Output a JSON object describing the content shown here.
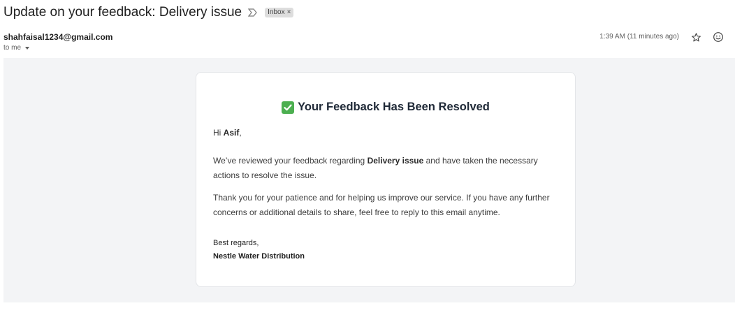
{
  "header": {
    "subject": "Update on your feedback: Delivery issue",
    "label": "Inbox",
    "label_remove": "×"
  },
  "message": {
    "sender": "shahfaisal1234@gmail.com",
    "to": "to me",
    "timestamp": "1:39 AM (11 minutes ago)"
  },
  "email": {
    "title": "Your Feedback Has Been Resolved",
    "greeting_prefix": "Hi ",
    "name": "Asif",
    "greeting_suffix": ",",
    "p1_prefix": "We’ve reviewed your feedback regarding ",
    "p1_topic": "Delivery issue",
    "p1_suffix_line1": " and have taken the necessary",
    "p1_line2": "actions to resolve the issue.",
    "p2_line1": "Thank you for your patience and for helping us improve our service. If you have any further",
    "p2_line2": "concerns or additional details to share, feel free to reply to this email anytime.",
    "signoff": "Best regards,",
    "company": "Nestle Water Distribution"
  },
  "icons": {
    "importance": "importance-marker-icon",
    "star": "star-icon",
    "emoji": "emoji-react-icon",
    "check": "check-mark-icon"
  },
  "colors": {
    "check_green": "#4caf50",
    "body_bg": "#f3f4f6"
  }
}
